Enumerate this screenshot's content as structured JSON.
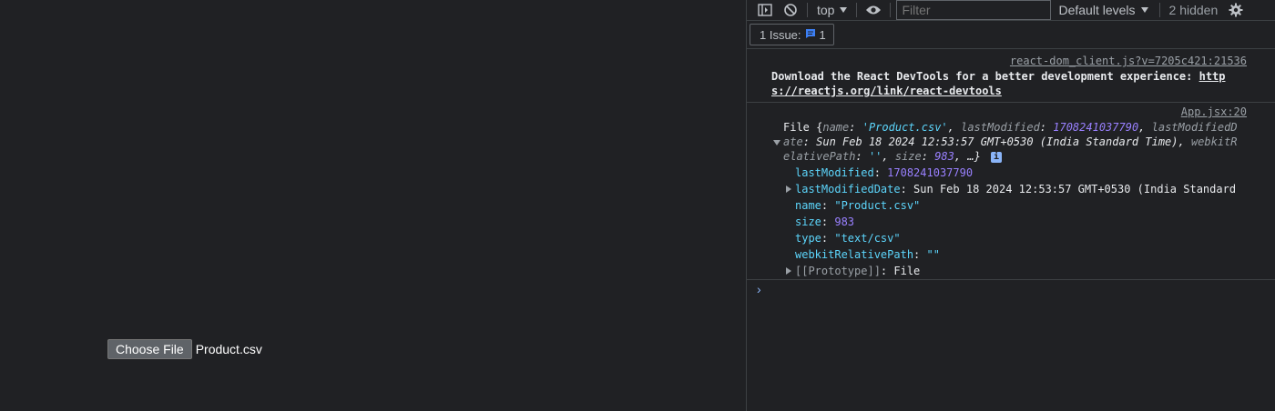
{
  "page": {
    "choose_file_label": "Choose File",
    "file_name": "Product.csv"
  },
  "toolbar": {
    "context": "top",
    "filter_placeholder": "Filter",
    "levels_label": "Default levels",
    "hidden_count": "2 hidden",
    "icons": [
      "sidebar-toggle-icon",
      "clear-console-icon",
      "eye-icon",
      "gear-icon"
    ]
  },
  "issues": {
    "label": "1 Issue:",
    "count": "1"
  },
  "console": {
    "msg1": {
      "source": "react-dom_client.js?v=7205c421:21536",
      "line1": "Download the React DevTools for a better development experience: ",
      "link_a": "http",
      "link_b": "s://reactjs.org/link/react-devtools"
    },
    "msg2": {
      "source": "App.jsx:20",
      "summary_file": "File {",
      "summary_name_key": "name",
      "summary_name_val": "'Product.csv'",
      "summary_lm_key": "lastModified",
      "summary_lm_val": "1708241037790",
      "summary_lmd_key_a": "lastModifiedD",
      "summary_lmd_key_b": "ate",
      "summary_lmd_val": "Sun Feb 18 2024 12:53:57 GMT+0530 (India Standard Time)",
      "summary_wrp_key_a": "webkitR",
      "summary_wrp_key_b": "elativePath",
      "summary_wrp_val": "''",
      "summary_size_key": "size",
      "summary_size_val": "983",
      "summary_tail": "…}",
      "props": [
        {
          "key": "lastModified",
          "value": "1708241037790",
          "kind": "num",
          "expandable": false
        },
        {
          "key": "lastModifiedDate",
          "value": "Sun Feb 18 2024 12:53:57 GMT+0530 (India Standard",
          "kind": "plain",
          "expandable": true
        },
        {
          "key": "name",
          "value": "\"Product.csv\"",
          "kind": "str",
          "expandable": false
        },
        {
          "key": "size",
          "value": "983",
          "kind": "num",
          "expandable": false
        },
        {
          "key": "type",
          "value": "\"text/csv\"",
          "kind": "str",
          "expandable": false
        },
        {
          "key": "webkitRelativePath",
          "value": "\"\"",
          "kind": "str",
          "expandable": false
        },
        {
          "key": "[[Prototype]]",
          "value": "File",
          "kind": "white",
          "expandable": true
        }
      ]
    }
  },
  "prompt": "›"
}
